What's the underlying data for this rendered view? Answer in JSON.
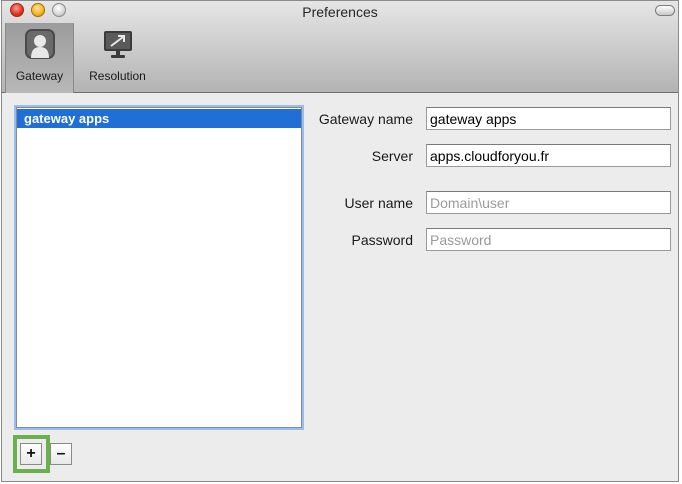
{
  "window": {
    "title": "Preferences"
  },
  "toolbar": {
    "items": [
      {
        "label": "Gateway",
        "icon": "gateway-icon",
        "selected": true
      },
      {
        "label": "Resolution",
        "icon": "monitor-icon",
        "selected": false
      }
    ]
  },
  "gateway_list": {
    "items": [
      {
        "label": "gateway apps",
        "selected": true
      }
    ]
  },
  "form": {
    "gateway_name": {
      "label": "Gateway name",
      "value": "gateway apps"
    },
    "server": {
      "label": "Server",
      "value": "apps.cloudforyou.fr"
    },
    "user_name": {
      "label": "User name",
      "placeholder": "Domain\\user"
    },
    "password": {
      "label": "Password",
      "placeholder": "Password"
    }
  },
  "list_buttons": {
    "add": "+",
    "remove": "–"
  },
  "colors": {
    "selection": "#1f6fd6",
    "highlight": "#6ab04c"
  }
}
